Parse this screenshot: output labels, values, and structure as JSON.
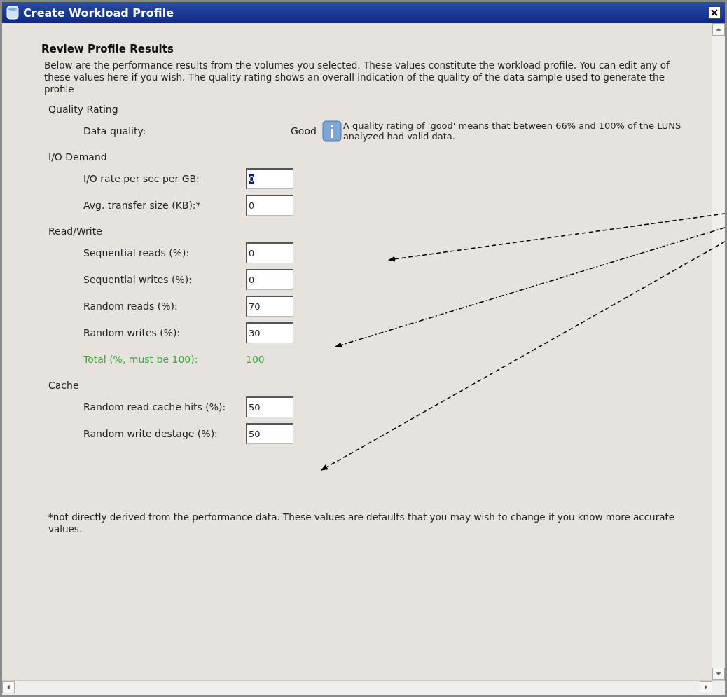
{
  "window": {
    "title": "Create Workload Profile"
  },
  "heading": "Review Profile Results",
  "intro": "Below are the performance results from the volumes you selected. These values constitute the workload profile. You can edit any of these values here if you wish. The quality rating shows an overall indication of the quality of the data sample used to generate the profile",
  "sections": [
    {
      "title": "Quality Rating",
      "rows": [
        {
          "kind": "rating",
          "label": "Data quality:",
          "value": "Good",
          "note": "A quality rating of 'good' means that between 66% and 100% of the LUNS analyzed had valid data."
        }
      ]
    },
    {
      "title": "I/O Demand",
      "rows": [
        {
          "kind": "field",
          "label": "I/O rate per sec per GB:",
          "value": "0",
          "highlighted": true
        },
        {
          "kind": "field",
          "label": "Avg. transfer size (KB):*",
          "value": "0",
          "highlighted": false
        }
      ]
    },
    {
      "title": "Read/Write",
      "rows": [
        {
          "kind": "field",
          "label": "Sequential reads (%):",
          "value": "0",
          "highlighted": false
        },
        {
          "kind": "field",
          "label": "Sequential writes (%):",
          "value": "0",
          "highlighted": false
        },
        {
          "kind": "field",
          "label": "Random reads (%):",
          "value": "70",
          "highlighted": false
        },
        {
          "kind": "field",
          "label": "Random writes (%):",
          "value": "30",
          "highlighted": false
        },
        {
          "kind": "total",
          "label": "Total (%, must be 100):",
          "value": "100"
        }
      ]
    },
    {
      "title": "Cache",
      "rows": [
        {
          "kind": "field",
          "label": "Random read cache hits (%):",
          "value": "50",
          "highlighted": false
        },
        {
          "kind": "field",
          "label": "Random write destage (%):",
          "value": "50",
          "highlighted": false
        }
      ]
    }
  ],
  "footnote": "*not directly derived from the performance data. These values are defaults that you may wish to change if you know more accurate values."
}
